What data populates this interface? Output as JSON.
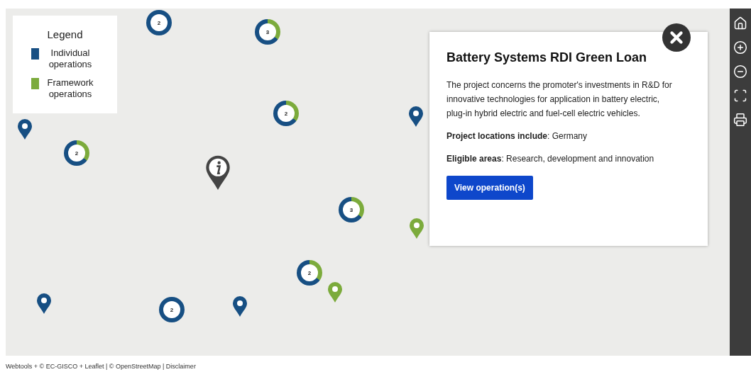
{
  "legend": {
    "title": "Legend",
    "items": [
      {
        "label": "Individual operations",
        "color": "#174f83"
      },
      {
        "label": "Framework operations",
        "color": "#7cab3c"
      }
    ]
  },
  "clusters": [
    {
      "count": "2",
      "kind": "individual"
    },
    {
      "count": "3",
      "kind": "mixed"
    },
    {
      "count": "2",
      "kind": "mixed"
    },
    {
      "count": "2",
      "kind": "mixed"
    },
    {
      "count": "3",
      "kind": "mixed"
    },
    {
      "count": "2",
      "kind": "mixed"
    },
    {
      "count": "2",
      "kind": "individual"
    }
  ],
  "pins": [
    {
      "kind": "individual"
    },
    {
      "kind": "individual"
    },
    {
      "kind": "framework"
    },
    {
      "kind": "framework"
    },
    {
      "kind": "individual"
    },
    {
      "kind": "individual"
    },
    {
      "kind": "info"
    }
  ],
  "popup": {
    "title": "Battery Systems RDI Green Loan",
    "description": "The project concerns the promoter's investments in R&D for innovative technologies for application in battery electric, plug-in hybrid electric and fuel-cell electric vehicles.",
    "details": [
      "**Project locations include**: Germany",
      "**Eligible areas**: Research, development and innovation"
    ],
    "button": "View operation(s)"
  },
  "toolbar": [
    {
      "kind": "home"
    },
    {
      "kind": "zoom-in"
    },
    {
      "kind": "zoom-out"
    },
    {
      "kind": "fullscreen"
    },
    {
      "kind": "print"
    }
  ],
  "attribution": "Webtools + © EC-GISCO + Leaflet | © OpenStreetMap | Disclaimer"
}
